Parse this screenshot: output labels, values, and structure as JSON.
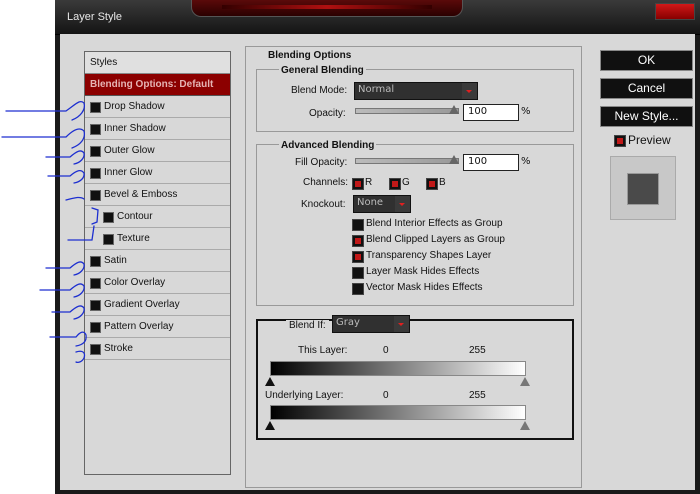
{
  "window": {
    "title": "Layer Style"
  },
  "styles": {
    "header": "Styles",
    "active": "Blending Options: Default",
    "items": [
      {
        "label": "Drop Shadow",
        "indent": 0
      },
      {
        "label": "Inner Shadow",
        "indent": 0
      },
      {
        "label": "Outer Glow",
        "indent": 0
      },
      {
        "label": "Inner Glow",
        "indent": 0
      },
      {
        "label": "Bevel & Emboss",
        "indent": 0
      },
      {
        "label": "Contour",
        "indent": 1
      },
      {
        "label": "Texture",
        "indent": 1
      },
      {
        "label": "Satin",
        "indent": 0
      },
      {
        "label": "Color Overlay",
        "indent": 0
      },
      {
        "label": "Gradient Overlay",
        "indent": 0
      },
      {
        "label": "Pattern Overlay",
        "indent": 0
      },
      {
        "label": "Stroke",
        "indent": 0
      }
    ]
  },
  "blending": {
    "title": "Blending Options",
    "general": {
      "title": "General Blending",
      "blend_mode_label": "Blend Mode:",
      "blend_mode_value": "Normal",
      "opacity_label": "Opacity:",
      "opacity_value": "100",
      "pct": "%"
    },
    "advanced": {
      "title": "Advanced Blending",
      "fill_opacity_label": "Fill Opacity:",
      "fill_opacity_value": "100",
      "pct": "%",
      "channels_label": "Channels:",
      "channels": [
        "R",
        "G",
        "B"
      ],
      "knockout_label": "Knockout:",
      "knockout_value": "None",
      "options": [
        {
          "label": "Blend Interior Effects as Group",
          "checked": false
        },
        {
          "label": "Blend Clipped Layers as Group",
          "checked": true
        },
        {
          "label": "Transparency Shapes Layer",
          "checked": true
        },
        {
          "label": "Layer Mask Hides Effects",
          "checked": false
        },
        {
          "label": "Vector Mask Hides Effects",
          "checked": false
        }
      ]
    },
    "blend_if": {
      "label": "Blend If:",
      "value": "Gray",
      "this_layer_label": "This Layer:",
      "this_layer_min": "0",
      "this_layer_max": "255",
      "underlying_label": "Underlying Layer:",
      "underlying_min": "0",
      "underlying_max": "255"
    }
  },
  "buttons": {
    "ok": "OK",
    "cancel": "Cancel",
    "new_style": "New Style...",
    "preview": "Preview"
  },
  "colors": {
    "accent": "#8c0000",
    "checkbox_on": "#c01818",
    "annotation": "#1d2fd0"
  }
}
